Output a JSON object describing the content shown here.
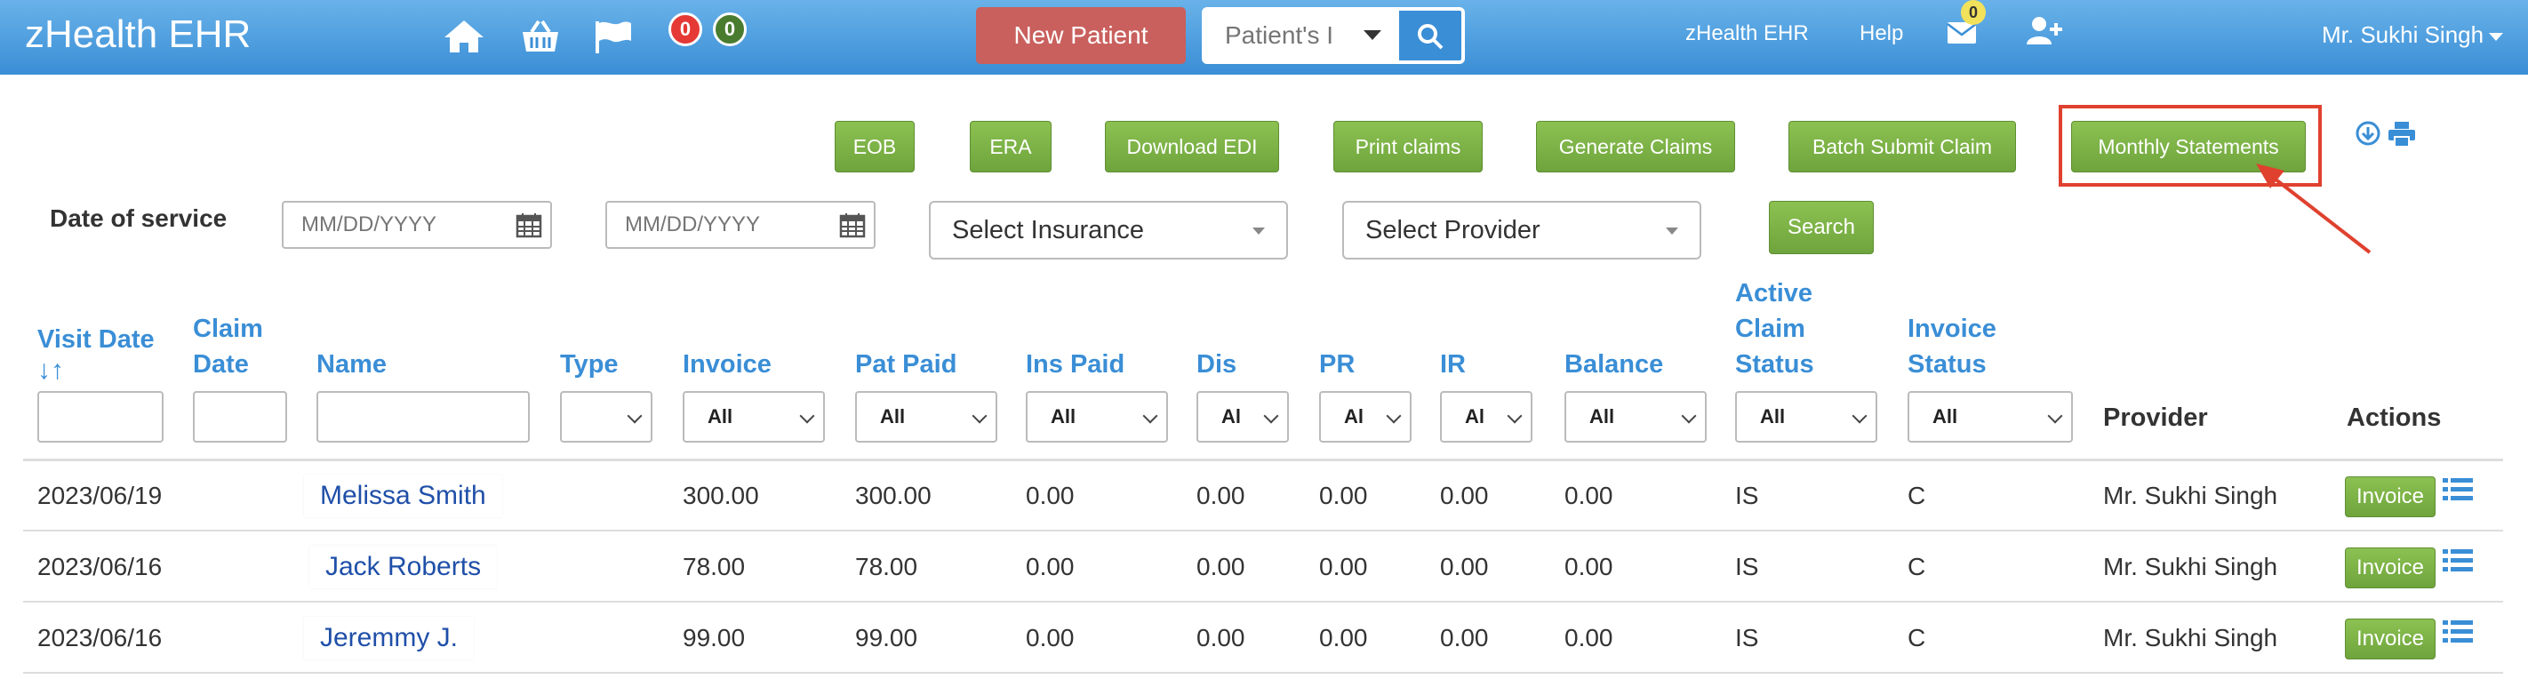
{
  "app": {
    "title": "zHealth EHR"
  },
  "nav": {
    "badge_red": "0",
    "badge_green": "0",
    "new_patient_label": "New Patient",
    "search_placeholder": "Patient's I",
    "links": [
      "zHealth EHR",
      "Help"
    ],
    "mail_count": "0",
    "user_name": "Mr. Sukhi Singh"
  },
  "actions": [
    "EOB",
    "ERA",
    "Download EDI",
    "Print claims",
    "Generate Claims",
    "Batch Submit Claim",
    "Monthly Statements"
  ],
  "filters": {
    "label": "Date of service",
    "date_placeholder": "MM/DD/YYYY",
    "insurance": "Select Insurance",
    "provider": "Select Provider",
    "search_label": "Search"
  },
  "columns": {
    "visit_date": "Visit Date",
    "sort_icon": "↓↑",
    "claim_date": [
      "Claim",
      "Date"
    ],
    "name": "Name",
    "type": "Type",
    "invoice": "Invoice",
    "pat_paid": "Pat Paid",
    "ins_paid": "Ins Paid",
    "dis": "Dis",
    "pr": "PR",
    "ir": "IR",
    "balance": "Balance",
    "active_claim_status": [
      "Active",
      "Claim",
      "Status"
    ],
    "invoice_status": [
      "Invoice",
      "Status"
    ],
    "provider": "Provider",
    "actions": "Actions"
  },
  "column_filters": {
    "all": "All",
    "short": "Al"
  },
  "rows": [
    {
      "visit_date": "2023/06/19",
      "name": "Melissa Smith",
      "invoice": "300.00",
      "pat_paid": "300.00",
      "ins_paid": "0.00",
      "dis": "0.00",
      "pr": "0.00",
      "ir": "0.00",
      "balance": "0.00",
      "claim_status": "IS",
      "invoice_status": "C",
      "provider": "Mr. Sukhi Singh",
      "action": "Invoice"
    },
    {
      "visit_date": "2023/06/16",
      "name": "Jack Roberts",
      "invoice": "78.00",
      "pat_paid": "78.00",
      "ins_paid": "0.00",
      "dis": "0.00",
      "pr": "0.00",
      "ir": "0.00",
      "balance": "0.00",
      "claim_status": "IS",
      "invoice_status": "C",
      "provider": "Mr. Sukhi Singh",
      "action": "Invoice"
    },
    {
      "visit_date": "2023/06/16",
      "name": "Jeremmy J.",
      "invoice": "99.00",
      "pat_paid": "99.00",
      "ins_paid": "0.00",
      "dis": "0.00",
      "pr": "0.00",
      "ir": "0.00",
      "balance": "0.00",
      "claim_status": "IS",
      "invoice_status": "C",
      "provider": "Mr. Sukhi Singh",
      "action": "Invoice"
    }
  ],
  "colors": {
    "header_blue": "#3a8ed6",
    "new_patient_red": "#c9605d",
    "button_green": "#7cb342",
    "badge_red": "#e53935",
    "badge_green": "#4a7c2f",
    "highlight_red": "#e0412f"
  },
  "icons": [
    "home-icon",
    "basket-icon",
    "flag-icon",
    "search-icon",
    "mail-icon",
    "add-user-icon",
    "download-icon",
    "print-icon",
    "calendar-icon",
    "list-icon",
    "sort-icon"
  ]
}
